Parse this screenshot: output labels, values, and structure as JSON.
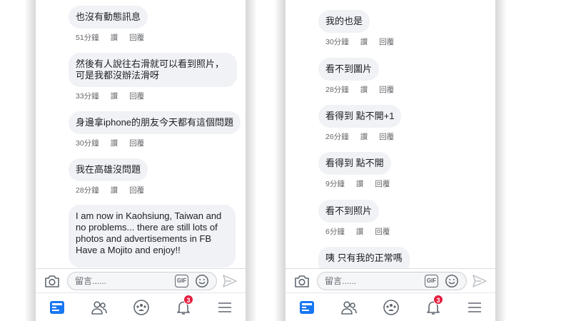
{
  "left": {
    "comments": [
      {
        "text": "也沒有動態訊息",
        "time": "51分鐘",
        "like": "讚",
        "reply": "回覆"
      },
      {
        "text": "然後有人說往右滑就可以看到照片，可是我都沒辦法滑呀",
        "time": "33分鐘",
        "like": "讚",
        "reply": "回覆"
      },
      {
        "text": "身邊拿iphone的朋友今天都有這個問題",
        "time": "30分鐘",
        "like": "讚",
        "reply": "回覆"
      },
      {
        "text": "我在高雄沒問題",
        "time": "28分鐘",
        "like": "讚",
        "reply": "回覆"
      },
      {
        "text": "I am now in Kaohsiung, Taiwan and no problems... there are still lots of photos and advertisements in FB Have a Mojito and enjoy!!",
        "time": "",
        "like": "",
        "reply": ""
      }
    ],
    "composer_placeholder": "留言......",
    "gif_label": "GIF",
    "notification_count": "3"
  },
  "right": {
    "comments": [
      {
        "text": "我的也是",
        "time": "30分鐘",
        "like": "讚",
        "reply": "回覆"
      },
      {
        "text": "看不到圖片",
        "time": "28分鐘",
        "like": "讚",
        "reply": "回覆"
      },
      {
        "text": "看得到 點不開+1",
        "time": "26分鐘",
        "like": "讚",
        "reply": "回覆"
      },
      {
        "text": "看得到 點不開",
        "time": "9分鐘",
        "like": "讚",
        "reply": "回覆"
      },
      {
        "text": "看不到照片",
        "time": "6分鐘",
        "like": "讚",
        "reply": "回覆"
      },
      {
        "text": "咦 只有我的正常嗎",
        "time": "",
        "like": "",
        "reply": ""
      }
    ],
    "composer_placeholder": "留言......",
    "gif_label": "GIF",
    "notification_count": "3"
  },
  "icons": [
    "camera-icon",
    "gif-icon",
    "smiley-icon",
    "send-icon",
    "news-feed-icon",
    "friends-icon",
    "groups-icon",
    "bell-icon",
    "menu-icon"
  ],
  "colors": {
    "accent": "#1877f2",
    "bubble": "#f0f2f5",
    "badge": "#e41e3f",
    "icon_gray": "#606770"
  }
}
